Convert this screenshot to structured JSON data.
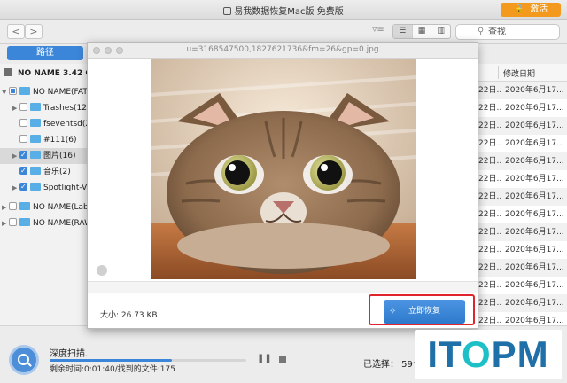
{
  "window": {
    "title": "易我数据恢复Mac版 免费版"
  },
  "header": {
    "activate_label": "激活"
  },
  "toolbar": {
    "back": "<",
    "forward": ">",
    "search_placeholder": "查找"
  },
  "path_tab": "路径",
  "tree": {
    "root": "NO NAME 3.42 GB",
    "items": [
      {
        "label": "NO NAME(FAT/",
        "checked": "partial",
        "expanded": true
      },
      {
        "label": "Trashes(12)",
        "checked": false
      },
      {
        "label": "fseventsd(2)",
        "checked": false
      },
      {
        "label": "#111(6)",
        "checked": false
      },
      {
        "label": "图片(16)",
        "checked": true,
        "selected": true
      },
      {
        "label": "音乐(2)",
        "checked": true
      },
      {
        "label": "Spotlight-V1",
        "checked": true
      },
      {
        "label": "NO NAME(Labe",
        "checked": false
      },
      {
        "label": "NO NAME(RAW",
        "checked": false
      }
    ]
  },
  "list": {
    "column_header": "修改日期",
    "rows": [
      {
        "col_a": "22日...",
        "date": "2020年6月17..."
      },
      {
        "col_a": "22日...",
        "date": "2020年6月17..."
      },
      {
        "col_a": "22日...",
        "date": "2020年6月17..."
      },
      {
        "col_a": "22日...",
        "date": "2020年6月17..."
      },
      {
        "col_a": "22日...",
        "date": "2020年6月17..."
      },
      {
        "col_a": "22日...",
        "date": "2020年6月17..."
      },
      {
        "col_a": "22日...",
        "date": "2020年6月17..."
      },
      {
        "col_a": "22日...",
        "date": "2020年6月17..."
      },
      {
        "col_a": "22日...",
        "date": "2020年6月17..."
      },
      {
        "col_a": "22日...",
        "date": "2020年6月17..."
      },
      {
        "col_a": "22日...",
        "date": "2020年6月17..."
      },
      {
        "col_a": "22日...",
        "date": "2020年6月17..."
      },
      {
        "col_a": "22日...",
        "date": "2020年6月17..."
      },
      {
        "col_a": "22日...",
        "date": "2020年6月17..."
      }
    ]
  },
  "modal": {
    "file_name": "u=3168547500,1827621736&fm=26&gp=0.jpg",
    "size_text": "大小: 26.73 KB",
    "recover_label": "立即恢复"
  },
  "status": {
    "scan_title": "深度扫描.",
    "scan_status": "剩余时间:0:01:40/找到的文件:175",
    "progress": 0.62,
    "selected": "已选择： 59个文"
  },
  "watermark": {
    "part1": "IT",
    "part2": "O",
    "part3": "PM"
  },
  "colors": {
    "accent": "#3b86d9",
    "activate": "#f39a1e",
    "highlight_box": "#e0242d"
  }
}
